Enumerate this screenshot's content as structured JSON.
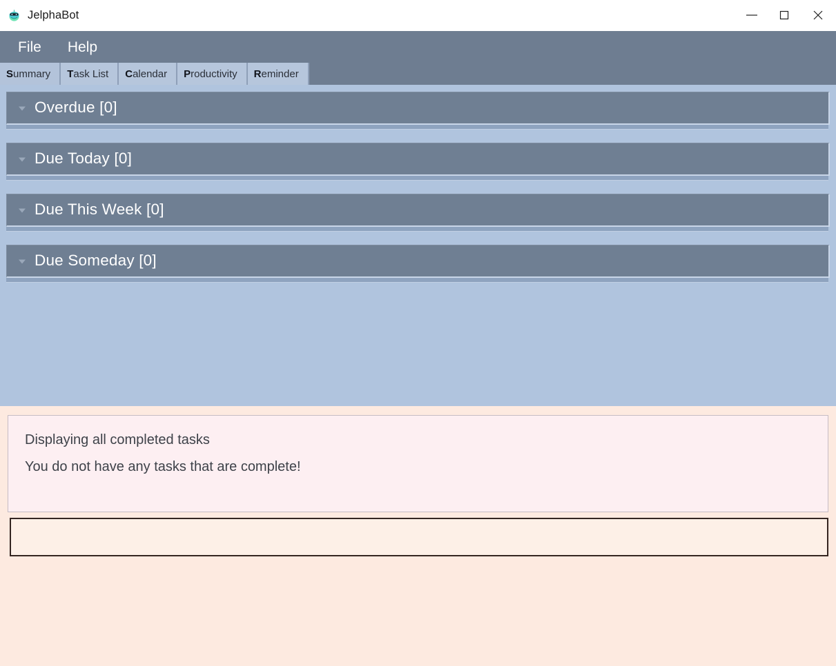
{
  "window": {
    "title": "JelphaBot",
    "icon": "robot-icon",
    "controls": {
      "minimize": "minimize-icon",
      "maximize": "maximize-icon",
      "close": "close-icon"
    }
  },
  "menubar": {
    "items": [
      {
        "label": "File"
      },
      {
        "label": "Help"
      }
    ]
  },
  "tabs": [
    {
      "mnemonic": "S",
      "rest": "ummary",
      "selected": true
    },
    {
      "mnemonic": "T",
      "rest": "ask List",
      "selected": false
    },
    {
      "mnemonic": "C",
      "rest": "alendar",
      "selected": false
    },
    {
      "mnemonic": "P",
      "rest": "roductivity",
      "selected": false
    },
    {
      "mnemonic": "R",
      "rest": "eminder",
      "selected": false
    }
  ],
  "summary": {
    "sections": [
      {
        "label": "Overdue [0]",
        "count": 0,
        "expanded": true,
        "chevron": "chevron-down-icon"
      },
      {
        "label": "Due Today [0]",
        "count": 0,
        "expanded": true,
        "chevron": "chevron-down-icon"
      },
      {
        "label": "Due This Week [0]",
        "count": 0,
        "expanded": true,
        "chevron": "chevron-down-icon"
      },
      {
        "label": "Due Someday [0]",
        "count": 0,
        "expanded": true,
        "chevron": "chevron-down-icon"
      }
    ]
  },
  "message_panel": {
    "lines": [
      "Displaying all completed tasks",
      "You do not have any tasks that are complete!"
    ]
  },
  "command_input": {
    "value": "",
    "placeholder": ""
  },
  "colors": {
    "titlebar_bg": "#ffffff",
    "menubar_bg": "#6e7d91",
    "tab_bg": "#b6c6dc",
    "tab_selected_bg": "#b3c3da",
    "content_bg": "#b0c4de",
    "section_header_bg": "#6f7f93",
    "section_header_text": "#ffffff",
    "message_area_bg": "#fdeae0",
    "message_panel_bg": "#fdeff2",
    "message_text": "#3e4249",
    "input_bg": "#fdf0e7",
    "input_border": "#332520"
  }
}
